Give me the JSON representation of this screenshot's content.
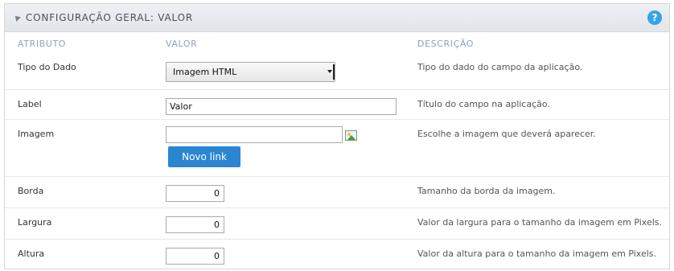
{
  "panel": {
    "title": "CONFIGURAÇÃO GERAL: VALOR",
    "help_label": "?"
  },
  "columns": {
    "attribute": "ATRIBUTO",
    "value": "VALOR",
    "description": "DESCRIÇÃO"
  },
  "rows": {
    "tipo": {
      "label": "Tipo do Dado",
      "value": "Imagem HTML",
      "description": "Tipo do dado do campo da aplicação."
    },
    "label": {
      "label": "Label",
      "value": "Valor",
      "description": "Título do campo na aplicação."
    },
    "imagem": {
      "label": "Imagem",
      "value": "",
      "button": "Novo link",
      "description": "Escolhe a imagem que deverá aparecer."
    },
    "borda": {
      "label": "Borda",
      "value": "0",
      "description": "Tamanho da borda da imagem."
    },
    "largura": {
      "label": "Largura",
      "value": "0",
      "description": "Valor da largura para o tamanho da imagem em Pixels."
    },
    "altura": {
      "label": "Altura",
      "value": "0",
      "description": "Valor da altura para o tamanho da imagem em Pixels."
    }
  },
  "colors": {
    "accent": "#2a86d1",
    "help": "#35a4e8",
    "column_header": "#8fa1b8"
  }
}
